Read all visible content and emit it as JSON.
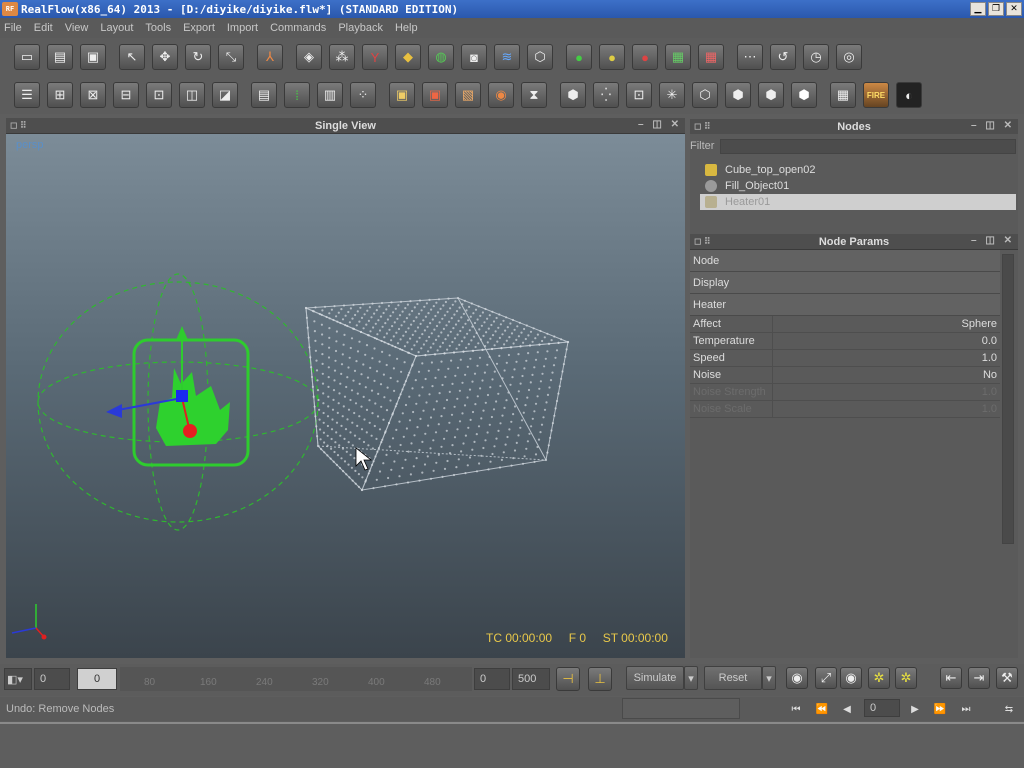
{
  "window": {
    "title": "RealFlow(x86_64) 2013 - [D:/diyike/diyike.flw*] (STANDARD EDITION)",
    "logo": "RF"
  },
  "menu": [
    "File",
    "Edit",
    "View",
    "Layout",
    "Tools",
    "Export",
    "Import",
    "Commands",
    "Playback",
    "Help"
  ],
  "viewport": {
    "title": "Single View",
    "camera": "persp",
    "tc": "TC 00:00:00",
    "frame": "F 0",
    "st": "ST 00:00:00"
  },
  "nodes_panel": {
    "title": "Nodes",
    "filter_label": "Filter",
    "items": [
      {
        "name": "Cube_top_open02",
        "icon": "cube-icon",
        "color": "#d8b840"
      },
      {
        "name": "Fill_Object01",
        "icon": "particles-icon",
        "color": "#b0b0b0"
      },
      {
        "name": "Heater01",
        "icon": "heater-icon",
        "color": "#e0d8b0"
      }
    ]
  },
  "node_params": {
    "title": "Node Params",
    "sections": [
      "Node",
      "Display",
      "Heater"
    ],
    "params": [
      {
        "label": "Affect",
        "value": "Sphere",
        "enabled": true
      },
      {
        "label": "Temperature",
        "value": "0.0",
        "enabled": true
      },
      {
        "label": "Speed",
        "value": "1.0",
        "enabled": true
      },
      {
        "label": "Noise",
        "value": "No",
        "enabled": true
      },
      {
        "label": "Noise Strength",
        "value": "1.0",
        "enabled": false
      },
      {
        "label": "Noise Scale",
        "value": "1.0",
        "enabled": false
      }
    ]
  },
  "timeline": {
    "start": "0",
    "current": "0",
    "ticks": [
      "80",
      "160",
      "240",
      "320",
      "400",
      "480"
    ],
    "range_start": "0",
    "range_end": "500",
    "simulate_label": "Simulate",
    "reset_label": "Reset"
  },
  "status": {
    "undo": "Undo: Remove Nodes",
    "frame_input": "0"
  },
  "colors": {
    "accent_hud": "#e8c84a",
    "persp_label": "#5a8fc8",
    "heater_green": "#2ecc2e"
  }
}
